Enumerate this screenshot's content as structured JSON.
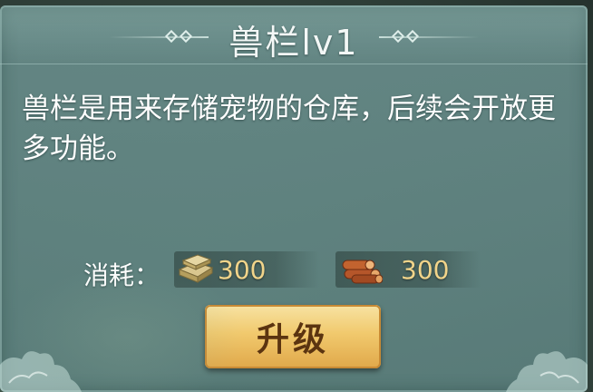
{
  "window": {
    "title": "兽栏lv1"
  },
  "description": "兽栏是用来存储宠物的仓库，后续会开放更多功能。",
  "cost": {
    "label": "消耗：",
    "items": [
      {
        "icon": "stone-icon",
        "value": "300"
      },
      {
        "icon": "wood-icon",
        "value": "300"
      }
    ]
  },
  "actions": {
    "upgrade_label": "升级"
  },
  "colors": {
    "panel": "#5c807e",
    "text": "#ffffff",
    "cost_value": "#f1d48a",
    "button": "#f1c96d",
    "button_text": "#5b3410"
  }
}
